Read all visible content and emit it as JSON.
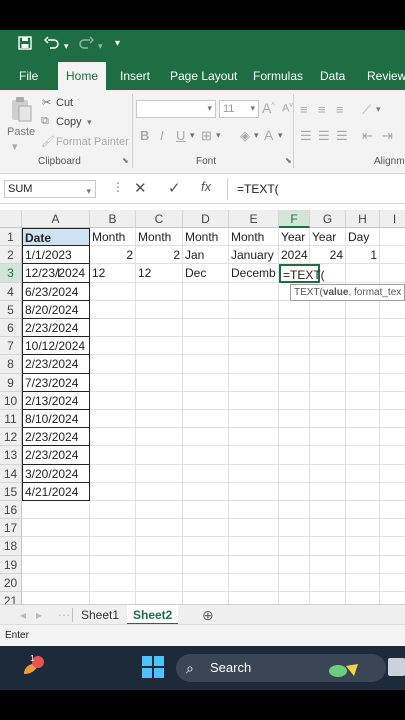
{
  "ribbon_tabs": [
    "File",
    "Home",
    "Insert",
    "Page Layout",
    "Formulas",
    "Data",
    "Review"
  ],
  "active_tab": "Home",
  "clipboard": {
    "paste": "Paste",
    "cut": "Cut",
    "copy": "Copy",
    "format_painter": "Format Painter",
    "group_label": "Clipboard"
  },
  "font": {
    "size": "11",
    "bold": "B",
    "italic": "I",
    "underline": "U",
    "group_label": "Font"
  },
  "alignment_group_label": "Alignm",
  "formula_bar": {
    "name_box": "SUM",
    "fx": "fx",
    "formula": "=TEXT("
  },
  "columns": [
    "A",
    "B",
    "C",
    "D",
    "E",
    "F",
    "G",
    "H",
    "I"
  ],
  "selected_column": "F",
  "rows": [
    "1",
    "2",
    "3",
    "4",
    "5",
    "6",
    "7",
    "8",
    "9",
    "10",
    "11",
    "12",
    "13",
    "14",
    "15",
    "16",
    "17",
    "18",
    "19",
    "20",
    "21"
  ],
  "selected_row": "3",
  "cells": {
    "A1": "Date",
    "B1": "Month",
    "C1": "Month",
    "D1": "Month",
    "E1": "Month",
    "F1": "Year",
    "G1": "Year",
    "H1": "Day",
    "A2": "1/1/2023",
    "B2": "2",
    "C2": "2",
    "D2": "Jan",
    "E2": "January",
    "F2": "2024",
    "G2": "24",
    "H2": "1",
    "A3": "12/23/2024",
    "B3": "12",
    "C3": "12",
    "D3": "Dec",
    "E3": "Decemb",
    "F3": "=TEXT(",
    "A4": "6/23/2024",
    "A5": "8/20/2024",
    "A6": "2/23/2024",
    "A7": "10/12/2024",
    "A8": "2/23/2024",
    "A9": "7/23/2024",
    "A10": "2/13/2024",
    "A11": "8/10/2024",
    "A12": "2/23/2024",
    "A13": "2/23/2024",
    "A14": "3/20/2024",
    "A15": "4/21/2024"
  },
  "tooltip": {
    "func": "TEXT(",
    "arg_bold": "value",
    "rest": ", format_tex"
  },
  "sheets": [
    "Sheet1",
    "Sheet2"
  ],
  "active_sheet": "Sheet2",
  "status": "Enter",
  "taskbar": {
    "search": "Search",
    "badge": "1"
  },
  "colors": {
    "excel_green": "#1f6e43",
    "header_fill": "#efefef",
    "selected_header": "#d2e5d7",
    "taskbar": "#1d2a3a"
  }
}
